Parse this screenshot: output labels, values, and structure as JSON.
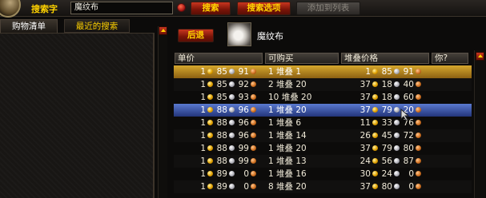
{
  "toolbar": {
    "search_label": "搜索字",
    "search_value": "魔纹布",
    "search_button": "搜索",
    "options_button": "搜索选项",
    "add_list_button": "添加到列表"
  },
  "tabs": [
    {
      "label": "购物清单"
    },
    {
      "label": "最近的搜索"
    }
  ],
  "item": {
    "back_button": "后退",
    "name": "魔纹布"
  },
  "table": {
    "headers": [
      "单价",
      "可购买",
      "堆叠价格",
      "你?"
    ],
    "rows": [
      {
        "g": "1",
        "s": "85",
        "c": "91",
        "buy": "1 堆叠 1",
        "sg": "1",
        "ss": "85",
        "sc": "91",
        "hl": "gold"
      },
      {
        "g": "1",
        "s": "85",
        "c": "92",
        "buy": "2 堆叠 20",
        "sg": "37",
        "ss": "18",
        "sc": "40",
        "hl": ""
      },
      {
        "g": "1",
        "s": "85",
        "c": "93",
        "buy": "10 堆叠 20",
        "sg": "37",
        "ss": "18",
        "sc": "60",
        "hl": ""
      },
      {
        "g": "1",
        "s": "88",
        "c": "96",
        "buy": "1 堆叠 20",
        "sg": "37",
        "ss": "79",
        "sc": "20",
        "hl": "blue"
      },
      {
        "g": "1",
        "s": "88",
        "c": "96",
        "buy": "1 堆叠 6",
        "sg": "11",
        "ss": "33",
        "sc": "76",
        "hl": ""
      },
      {
        "g": "1",
        "s": "88",
        "c": "96",
        "buy": "1 堆叠 14",
        "sg": "26",
        "ss": "45",
        "sc": "72",
        "hl": ""
      },
      {
        "g": "1",
        "s": "88",
        "c": "99",
        "buy": "1 堆叠 20",
        "sg": "37",
        "ss": "79",
        "sc": "80",
        "hl": ""
      },
      {
        "g": "1",
        "s": "88",
        "c": "99",
        "buy": "1 堆叠 13",
        "sg": "24",
        "ss": "56",
        "sc": "87",
        "hl": ""
      },
      {
        "g": "1",
        "s": "89",
        "c": "0",
        "buy": "1 堆叠 16",
        "sg": "30",
        "ss": "24",
        "sc": "0",
        "hl": ""
      },
      {
        "g": "1",
        "s": "89",
        "c": "0",
        "buy": "8 堆叠 20",
        "sg": "37",
        "ss": "80",
        "sc": "0",
        "hl": ""
      }
    ]
  },
  "icons": {
    "clear": "clear-search-icon",
    "item": "runecloth-item-icon",
    "character": "character-portrait"
  },
  "colors": {
    "accent": "#ffd200",
    "button": "#a01e0c",
    "highlight_gold": "#d6a82e",
    "highlight_blue": "#4a66c0"
  }
}
